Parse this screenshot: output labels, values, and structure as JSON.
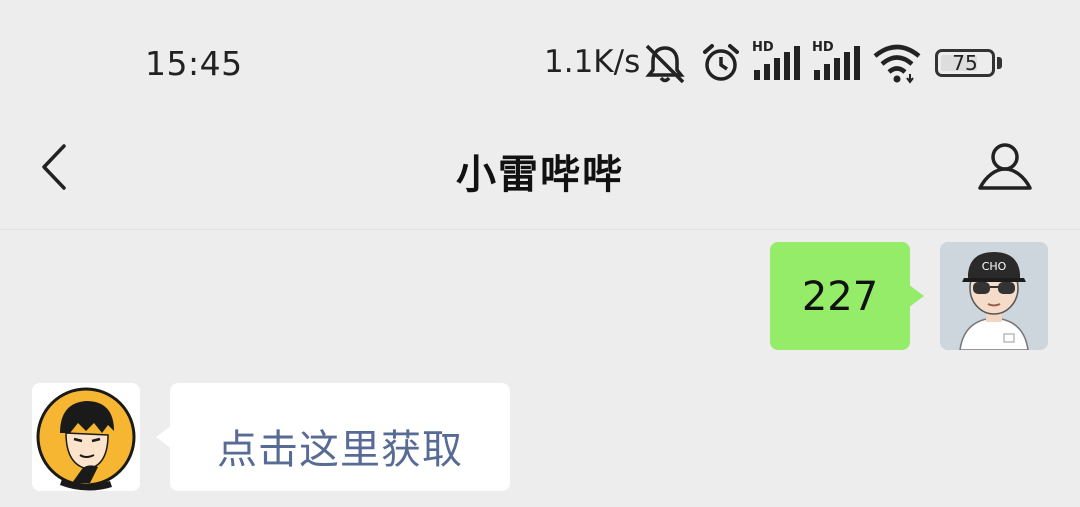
{
  "status_bar": {
    "time": "15:45",
    "net_speed": "1.1K/s",
    "signal_1_label": "HD",
    "signal_2_label": "HD",
    "battery_level": "75",
    "battery_fraction": 0.75,
    "icons": [
      "mute-icon",
      "alarm-icon",
      "signal-hd-icon",
      "signal-hd-icon",
      "wifi-icon",
      "battery-icon"
    ]
  },
  "nav": {
    "title": "小雷哔哔",
    "back_icon": "chevron-left-icon",
    "profile_icon": "person-icon"
  },
  "messages": [
    {
      "direction": "out",
      "text": "227",
      "bubble_color": "#95ec69"
    },
    {
      "direction": "in",
      "text": "点击这里获取",
      "link_color": "#576b95"
    }
  ]
}
